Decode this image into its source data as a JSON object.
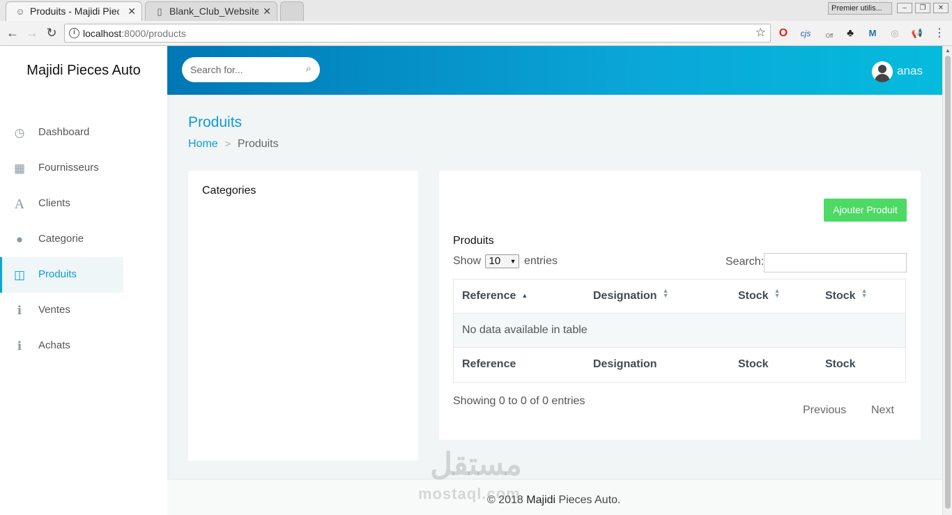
{
  "browser": {
    "tabs": [
      {
        "title": "Produits - Majidi Pieces Auto"
      },
      {
        "title": "Blank_Club_Website"
      }
    ],
    "profile_label": "Premier utilis...",
    "url_host": "localhost",
    "url_path": ":8000/products",
    "extensions": [
      "opera-icon",
      "cjs-icon",
      "off-icon",
      "gnome-icon",
      "m-icon",
      "extension-icon",
      "megaphone-icon",
      "menu-icon"
    ],
    "ext_text": {
      "cjs": "cjs",
      "off": "Off"
    }
  },
  "app": {
    "brand_bold": "Majidi",
    "brand_rest": "Pieces Auto"
  },
  "sidebar": {
    "items": [
      {
        "label": "Dashboard",
        "icon": "clock-icon",
        "glyph": "◷",
        "active": false
      },
      {
        "label": "Fournisseurs",
        "icon": "table-icon",
        "glyph": "▦",
        "active": false
      },
      {
        "label": "Clients",
        "icon": "font-icon",
        "glyph": "A",
        "active": false
      },
      {
        "label": "Categorie",
        "icon": "globe-icon",
        "glyph": "●",
        "active": false
      },
      {
        "label": "Produits",
        "icon": "columns-icon",
        "glyph": "◫",
        "active": true
      },
      {
        "label": "Ventes",
        "icon": "info-icon",
        "glyph": "ℹ",
        "active": false
      },
      {
        "label": "Achats",
        "icon": "info-icon",
        "glyph": "ℹ",
        "active": false
      }
    ]
  },
  "header": {
    "search_placeholder": "Search for...",
    "username": "anas"
  },
  "page": {
    "title": "Produits",
    "breadcrumb_home": "Home",
    "breadcrumb_sep": ">",
    "breadcrumb_current": "Produits"
  },
  "categories": {
    "title": "Categories"
  },
  "products": {
    "add_button": "Ajouter Produit",
    "title": "Produits",
    "show_label": "Show",
    "entries_value": "10",
    "entries_label": "entries",
    "search_label": "Search:",
    "columns": [
      "Reference",
      "Designation",
      "Stock",
      "Stock"
    ],
    "empty_message": "No data available in table",
    "info": "Showing 0 to 0 of 0 entries",
    "prev": "Previous",
    "next": "Next"
  },
  "footer": {
    "prefix": "© 2018",
    "brand_bold": "Majidi",
    "brand_rest": "Pieces Auto."
  },
  "watermark": {
    "arabic": "مستقل",
    "latin": "mostaql.com"
  }
}
